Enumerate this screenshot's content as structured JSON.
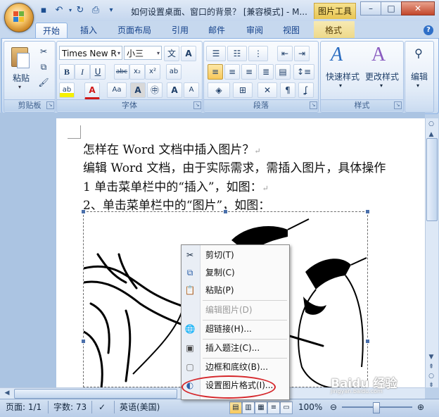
{
  "window": {
    "title": "如何设置桌面、窗口的背景？ [兼容模式] - M...",
    "context_tab_title": "图片工具",
    "buttons": {
      "minimize": "–",
      "maximize": "□",
      "close": "✕"
    }
  },
  "quick_access": [
    "save-icon",
    "undo-icon",
    "redo-icon",
    "print-preview-icon",
    "customize-icon"
  ],
  "tabs": [
    {
      "label": "开始",
      "active": true
    },
    {
      "label": "插入"
    },
    {
      "label": "页面布局"
    },
    {
      "label": "引用"
    },
    {
      "label": "邮件"
    },
    {
      "label": "审阅"
    },
    {
      "label": "视图"
    },
    {
      "label": "格式",
      "contextual": true
    }
  ],
  "ribbon": {
    "clipboard": {
      "label": "剪贴板",
      "paste": "粘贴"
    },
    "font": {
      "label": "字体",
      "font_name": "Times New R",
      "font_size": "小三",
      "bold": "B",
      "italic": "I",
      "underline": "U",
      "strike": "abc",
      "subscript": "x₂",
      "superscript": "x²",
      "highlight": "ab",
      "color": "A",
      "case": "Aa",
      "grow": "A",
      "shrink": "A"
    },
    "paragraph": {
      "label": "段落"
    },
    "styles": {
      "label": "样式",
      "quick_styles": "快速样式",
      "change_styles": "更改样式"
    },
    "editing": {
      "label": "编辑"
    }
  },
  "document": {
    "lines": [
      "怎样在 Word 文档中插入图片？",
      "编辑 Word 文档，由于实际需求，需插入图片，具体操作",
      "1 单击菜单栏中的“插入”，如图：",
      "2、单击菜单栏中的“图片”，如图："
    ],
    "para_mark": "↵"
  },
  "context_menu": {
    "items": [
      {
        "label": "剪切(T)",
        "icon": "scissors-icon",
        "disabled": false
      },
      {
        "label": "复制(C)",
        "icon": "copy-icon",
        "disabled": false
      },
      {
        "label": "粘贴(P)",
        "icon": "paste-icon",
        "disabled": false
      },
      {
        "label": "编辑图片(D)",
        "icon": "",
        "disabled": true
      },
      {
        "label": "超链接(H)...",
        "icon": "hyperlink-icon",
        "disabled": false
      },
      {
        "label": "插入题注(C)...",
        "icon": "caption-icon",
        "disabled": false
      },
      {
        "label": "边框和底纹(B)...",
        "icon": "borders-icon",
        "disabled": false
      },
      {
        "label": "设置图片格式(I)...",
        "icon": "format-picture-icon",
        "disabled": false
      }
    ]
  },
  "status": {
    "page": "页面: 1/1",
    "words": "字数: 73",
    "language": "英语(美国)",
    "zoom": "100%"
  },
  "watermark": {
    "text": "Baidu 经验",
    "url": "jingyan.baidu.com"
  },
  "colors": {
    "accent": "#15428b",
    "ribbon": "#dbe7f6",
    "highlight_oval": "#d5262a"
  }
}
